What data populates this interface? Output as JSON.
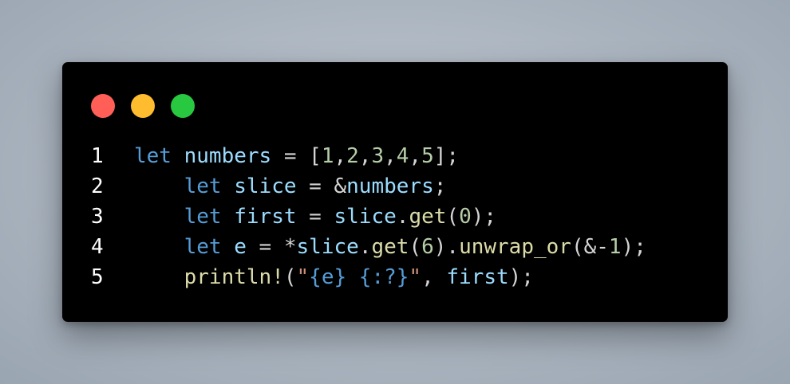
{
  "window": {
    "controls": [
      {
        "name": "close",
        "color": "#ff5f57"
      },
      {
        "name": "minimize",
        "color": "#febc2e"
      },
      {
        "name": "maximize",
        "color": "#28c840"
      }
    ]
  },
  "code": {
    "language": "rust",
    "lines": [
      {
        "number": "1",
        "tokens": [
          {
            "t": "let",
            "c": "kw"
          },
          {
            "t": " ",
            "c": "p"
          },
          {
            "t": "numbers",
            "c": "var"
          },
          {
            "t": " = [",
            "c": "p"
          },
          {
            "t": "1",
            "c": "num"
          },
          {
            "t": ",",
            "c": "p"
          },
          {
            "t": "2",
            "c": "num"
          },
          {
            "t": ",",
            "c": "p"
          },
          {
            "t": "3",
            "c": "num"
          },
          {
            "t": ",",
            "c": "p"
          },
          {
            "t": "4",
            "c": "num"
          },
          {
            "t": ",",
            "c": "p"
          },
          {
            "t": "5",
            "c": "num"
          },
          {
            "t": "];",
            "c": "p"
          }
        ]
      },
      {
        "number": "2",
        "tokens": [
          {
            "t": "    ",
            "c": "p"
          },
          {
            "t": "let",
            "c": "kw"
          },
          {
            "t": " ",
            "c": "p"
          },
          {
            "t": "slice",
            "c": "var"
          },
          {
            "t": " = &",
            "c": "p"
          },
          {
            "t": "numbers",
            "c": "var"
          },
          {
            "t": ";",
            "c": "p"
          }
        ]
      },
      {
        "number": "3",
        "tokens": [
          {
            "t": "    ",
            "c": "p"
          },
          {
            "t": "let",
            "c": "kw"
          },
          {
            "t": " ",
            "c": "p"
          },
          {
            "t": "first",
            "c": "var"
          },
          {
            "t": " = ",
            "c": "p"
          },
          {
            "t": "slice",
            "c": "var"
          },
          {
            "t": ".",
            "c": "p"
          },
          {
            "t": "get",
            "c": "fn"
          },
          {
            "t": "(",
            "c": "p"
          },
          {
            "t": "0",
            "c": "num"
          },
          {
            "t": ");",
            "c": "p"
          }
        ]
      },
      {
        "number": "4",
        "tokens": [
          {
            "t": "    ",
            "c": "p"
          },
          {
            "t": "let",
            "c": "kw"
          },
          {
            "t": " ",
            "c": "p"
          },
          {
            "t": "e",
            "c": "var"
          },
          {
            "t": " = *",
            "c": "p"
          },
          {
            "t": "slice",
            "c": "var"
          },
          {
            "t": ".",
            "c": "p"
          },
          {
            "t": "get",
            "c": "fn"
          },
          {
            "t": "(",
            "c": "p"
          },
          {
            "t": "6",
            "c": "num"
          },
          {
            "t": ").",
            "c": "p"
          },
          {
            "t": "unwrap_or",
            "c": "fn"
          },
          {
            "t": "(&-",
            "c": "p"
          },
          {
            "t": "1",
            "c": "num"
          },
          {
            "t": ");",
            "c": "p"
          }
        ]
      },
      {
        "number": "5",
        "tokens": [
          {
            "t": "    ",
            "c": "p"
          },
          {
            "t": "println!",
            "c": "fn"
          },
          {
            "t": "(",
            "c": "p"
          },
          {
            "t": "\"",
            "c": "str"
          },
          {
            "t": "{e} {:?}",
            "c": "fmt"
          },
          {
            "t": "\"",
            "c": "str"
          },
          {
            "t": ", ",
            "c": "p"
          },
          {
            "t": "first",
            "c": "var"
          },
          {
            "t": ");",
            "c": "p"
          }
        ]
      }
    ]
  }
}
